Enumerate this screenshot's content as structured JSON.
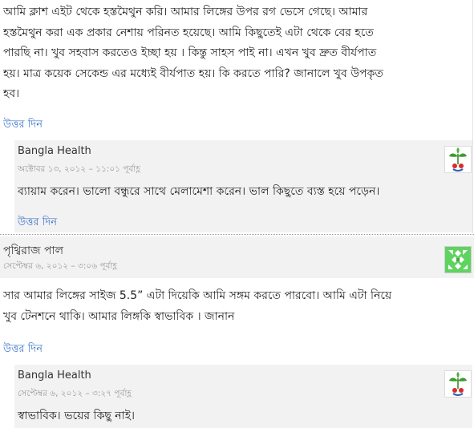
{
  "comment1": {
    "text_lines": [
      "আমি ক্লাশ এইট থেকে হস্তমৈথুন করি। আমার লিঙ্গের উপর রগ ভেসে গেছে। আমার",
      "হস্তমৈথুন করা এক প্রকার নেশায় পরিনত হয়েছে। আমি কিছুতেই এটা থেকে বের হতে",
      "পারছি না। খুব সহবাস করতেও ইচ্ছা হয় । কিন্তু সাহস পাই না। এখন খুব দ্রুত বীর্যপাত",
      "হয়। মাত্র কয়েক সেকেন্ড এর মধ্যেই বীর্যপাত হয়। কি করতে পারি? জানালে খুব উপকৃত",
      "হব।"
    ],
    "reply_label": "উত্তর দিন"
  },
  "reply1": {
    "author": "Bangla Health",
    "date": "অক্টোবর ১৩, ২০১২ – ১১:০১ পূর্বাহ্ণ",
    "text": "ব্যায়াম করেন। ভালো বন্ধুরে সাথে মেলামেশা করেন। ভাল কিছুতে ব্যস্ত হয়ে পড়েন।",
    "reply_label": "উত্তর দিন",
    "avatar_icon": "plant-logo-icon"
  },
  "comment2": {
    "author": "পৃথ্বিরাজ পাল",
    "date": "সেপ্টেম্বর ৬, ২০১২ – ৩:০৬ পূর্বাহ্ণ",
    "text_lines": [
      "সার আমার লিঙ্গের সাইজ 5.5” এটা দিয়েকি আমি সঙ্গম করতে পারবো। আমি এটা নিয়ে",
      "খুব টেনশনে থাকি। আমার লিঙ্গকি স্বাভাবিক । জানান"
    ],
    "reply_label": "উত্তর দিন",
    "avatar_icon": "identicon-avatar"
  },
  "reply2": {
    "author": "Bangla Health",
    "date": "সেপ্টেম্বর ৬, ২০১২ – ৩:২৭ পূর্বাহ্ণ",
    "text": "স্বাভাবিক। ভয়ের কিছু নাই।",
    "avatar_icon": "plant-logo-icon"
  },
  "colors": {
    "link": "#3a73c9",
    "reply_bg": "#f2f2f2",
    "date": "#9a9a9a",
    "identicon": "#5fd35f"
  }
}
